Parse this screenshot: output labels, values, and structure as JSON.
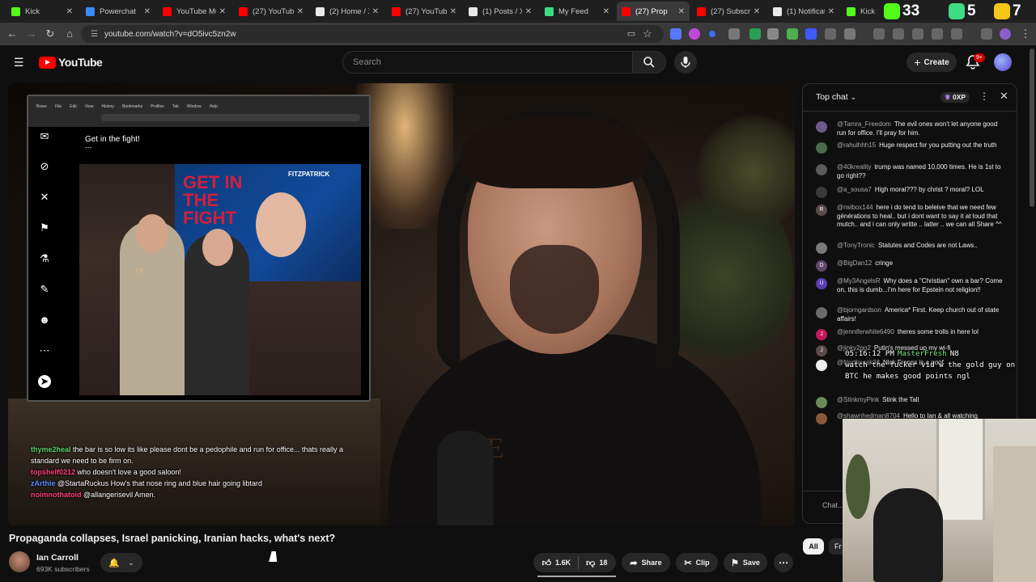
{
  "browser": {
    "tabs": [
      {
        "title": "Kick",
        "color": "#53fc18"
      },
      {
        "title": "Powerchat",
        "color": "#3a8bff"
      },
      {
        "title": "YouTube Mu",
        "color": "#ff0000"
      },
      {
        "title": "(27) YouTube",
        "color": "#ff0000"
      },
      {
        "title": "(2) Home / X",
        "color": "#e7e9ea"
      },
      {
        "title": "(27) YouTube",
        "color": "#ff0000"
      },
      {
        "title": "(1) Posts / X",
        "color": "#e7e9ea"
      },
      {
        "title": "My Feed",
        "color": "#3ddc84"
      },
      {
        "title": "(27) Prop",
        "color": "#ff0000"
      },
      {
        "title": "(27) Subscrip",
        "color": "#ff0000"
      },
      {
        "title": "(1) Notificati",
        "color": "#e7e9ea"
      },
      {
        "title": "Kick",
        "color": "#53fc18"
      }
    ],
    "url": "youtube.com/watch?v=dO5ivc5zn2w",
    "overlay_counters": {
      "kick": "33",
      "rumble": "5",
      "other": "7"
    }
  },
  "header": {
    "logo_text": "YouTube",
    "search_placeholder": "Search",
    "create_label": "Create",
    "notif_badge": "9+"
  },
  "video": {
    "embed": {
      "menu": [
        "Brave",
        "File",
        "Edit",
        "View",
        "History",
        "Bookmarks",
        "Profiles",
        "Tab",
        "Window",
        "Help"
      ],
      "post_text": "Get in the fight!",
      "post_more": "...",
      "tv_text": "GET IN THE FIGHT",
      "tv_brand": "FITZPATRICK"
    },
    "shirt_text": "ATE",
    "overlay_chat": [
      {
        "user": "thyme2heal",
        "color": "green",
        "text": "the bar is so low its like please dont be a pedophile and run for office... thats really a"
      },
      {
        "user": "",
        "color": "green",
        "text": "standard we need to be firm on."
      },
      {
        "user": "topshelf0212",
        "color": "pink",
        "text": "who doesn't love a good saloon!"
      },
      {
        "user": "zArthie",
        "color": "blue",
        "text": "@StartaRuckus How's that nose ring and blue hair going libtard"
      },
      {
        "user": "noimnothatoid",
        "color": "pink",
        "text": "@allangerisevil Amen."
      }
    ]
  },
  "below": {
    "title": "Propaganda collapses, Israel panicking, Iranian hacks, what's next?",
    "channel": "Ian Carroll",
    "subscribers": "693K subscribers",
    "likes": "1.6K",
    "dislikes": "18",
    "share": "Share",
    "clip": "Clip",
    "save": "Save",
    "chips": [
      "All",
      "Fr"
    ]
  },
  "chat": {
    "title": "Top chat",
    "xp": "0XP",
    "input_placeholder": "Chat...",
    "messages": [
      {
        "user": "@Tamra_Freedom",
        "text": "The evil ones won't let anyone good run for office. I'll pray for him.",
        "avatar": "",
        "color": "#6b5a8a"
      },
      {
        "user": "@rahulhhh15",
        "text": "Huge respect for you putting out the truth",
        "avatar": "",
        "color": "#4a6a4a"
      },
      {
        "user": "@40kreality",
        "text": "trump was named 10,000 times. He is 1st to go right??",
        "avatar": "",
        "color": "#5a5a5a"
      },
      {
        "user": "@a_sousa7",
        "text": "High moral??? by christ ? moral? LOL",
        "avatar": "",
        "color": "#3a3a3a"
      },
      {
        "user": "@rwibox144",
        "text": "here i do tend to beleive that we need few générations to heal.. but i dont want to say it at loud that mutch.. and i can only writte .. latter .. we can all Share ^^",
        "avatar": "R",
        "color": "#5c4b4b"
      },
      {
        "user": "@TonyTronic",
        "text": "Statutes and Codes are not Laws..",
        "avatar": "",
        "color": "#7a7a7a"
      },
      {
        "user": "@BigDan12",
        "text": "cringe",
        "avatar": "D",
        "color": "#5e4a6a"
      },
      {
        "user": "@My3AngelsR",
        "text": "Why does a \"Christian\" own a bar? Come on, this is dumb...I'm here for Epstein not religion!!",
        "avatar": "U",
        "color": "#5b3fb0"
      },
      {
        "user": "@bjorngardson",
        "text": "America* First. Keep church out of state affairs!",
        "avatar": "",
        "color": "#6a6a6a"
      },
      {
        "user": "@jenniferwhite6490",
        "text": "theres some trolls in here lol",
        "avatar": "J",
        "color": "#c2185b"
      },
      {
        "user": "@jinky2go2",
        "text": "Putin's messed up my wi-fi",
        "avatar": "J",
        "color": "#5a4a4a"
      },
      {
        "user": "@Northsask33",
        "text": "Nick Frenss is a goof",
        "avatar": "",
        "color": "#eeeeee"
      },
      {
        "user": "@StinkmyPink",
        "text": "Stink the Tall",
        "avatar": "",
        "color": "#6a8a5a"
      },
      {
        "user": "@shawnhedman8704",
        "text": "Hello to Ian & all watching",
        "avatar": "",
        "color": "#8a5a3a"
      }
    ]
  },
  "stream_overlay": {
    "time": "05:16:12 PM",
    "user": "MasterFresh",
    "tag": "N8",
    "text": "watch the fucker vid w the gold guy on BTC he makes good points ngl"
  }
}
